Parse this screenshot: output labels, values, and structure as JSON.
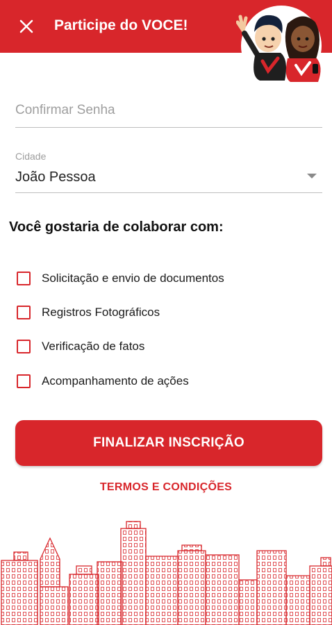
{
  "header": {
    "title": "Participe do VOCE!",
    "background": "#d8262b"
  },
  "form": {
    "password_confirm": {
      "placeholder": "Confirmar Senha",
      "value": ""
    },
    "city": {
      "label": "Cidade",
      "value": "João Pessoa"
    }
  },
  "collaboration": {
    "title": "Você gostaria de colaborar com:",
    "options": [
      {
        "label": "Solicitação e envio de documentos",
        "checked": false
      },
      {
        "label": "Registros Fotográficos",
        "checked": false
      },
      {
        "label": "Verificação de fatos",
        "checked": false
      },
      {
        "label": "Acompanhamento de ações",
        "checked": false
      }
    ]
  },
  "actions": {
    "submit_label": "FINALIZAR INSCRIÇÃO",
    "terms_label": "TERMOS E CONDIÇÕES"
  },
  "icons": {
    "close": "close-icon",
    "dropdown": "chevron-down-icon",
    "mascots": "mascot-illustration",
    "skyline": "city-skyline-illustration"
  },
  "colors": {
    "primary": "#d8262b",
    "divider": "#bdbdbd",
    "hint": "#9e9e9e"
  }
}
